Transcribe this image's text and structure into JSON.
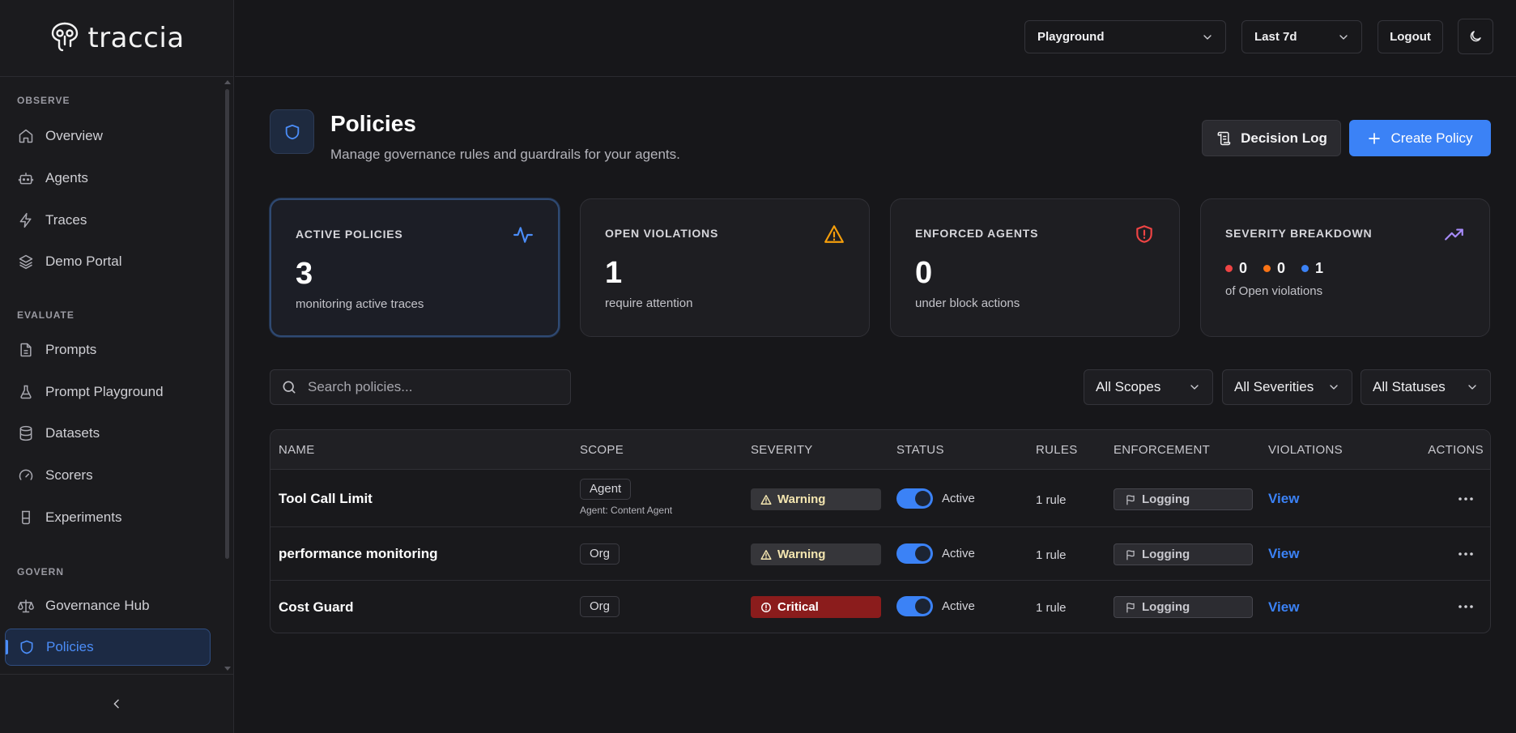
{
  "app": {
    "logo_text": "traccia"
  },
  "sidebar": {
    "sections": [
      {
        "label": "OBSERVE"
      },
      {
        "label": "EVALUATE"
      },
      {
        "label": "GOVERN"
      }
    ],
    "items": [
      {
        "label": "Overview",
        "icon": "home-icon"
      },
      {
        "label": "Agents",
        "icon": "bot-icon"
      },
      {
        "label": "Traces",
        "icon": "zap-icon"
      },
      {
        "label": "Demo Portal",
        "icon": "layers-icon"
      },
      {
        "label": "Prompts",
        "icon": "file-text-icon"
      },
      {
        "label": "Prompt Playground",
        "icon": "flask-icon"
      },
      {
        "label": "Datasets",
        "icon": "database-icon"
      },
      {
        "label": "Scorers",
        "icon": "gauge-icon"
      },
      {
        "label": "Experiments",
        "icon": "beaker-icon"
      },
      {
        "label": "Governance Hub",
        "icon": "scale-icon"
      },
      {
        "label": "Policies",
        "icon": "shield-icon",
        "active": true
      }
    ]
  },
  "header": {
    "project_select": "Playground",
    "range_select": "Last 7d",
    "logout_label": "Logout"
  },
  "page": {
    "title": "Policies",
    "subtitle": "Manage governance rules and guardrails for your agents.",
    "decision_log_label": "Decision Log",
    "create_label": "Create Policy"
  },
  "stats": {
    "active": {
      "label": "ACTIVE POLICIES",
      "value": "3",
      "sub": "monitoring active traces"
    },
    "violations": {
      "label": "OPEN VIOLATIONS",
      "value": "1",
      "sub": "require attention"
    },
    "enforced": {
      "label": "ENFORCED AGENTS",
      "value": "0",
      "sub": "under block actions"
    },
    "severity": {
      "label": "SEVERITY BREAKDOWN",
      "critical": "0",
      "warning": "0",
      "info": "1",
      "sub": "of Open violations",
      "colors": {
        "critical": "#ef4444",
        "warning": "#f97316",
        "info": "#3b82f6"
      }
    }
  },
  "filters": {
    "search_placeholder": "Search policies...",
    "scope": "All Scopes",
    "severity": "All Severities",
    "status": "All Statuses"
  },
  "table": {
    "headers": [
      "NAME",
      "SCOPE",
      "SEVERITY",
      "STATUS",
      "RULES",
      "ENFORCEMENT",
      "VIOLATIONS",
      "ACTIONS"
    ],
    "rows": [
      {
        "name": "Tool Call Limit",
        "scope": "Agent",
        "scope_sub": "Agent: Content Agent",
        "severity": "Warning",
        "status": "Active",
        "rules": "1 rule",
        "enforcement": "Logging",
        "violations": "View"
      },
      {
        "name": "performance monitoring",
        "scope": "Org",
        "scope_sub": "",
        "severity": "Warning",
        "status": "Active",
        "rules": "1 rule",
        "enforcement": "Logging",
        "violations": "View"
      },
      {
        "name": "Cost Guard",
        "scope": "Org",
        "scope_sub": "",
        "severity": "Critical",
        "status": "Active",
        "rules": "1 rule",
        "enforcement": "Logging",
        "violations": "View"
      }
    ]
  }
}
